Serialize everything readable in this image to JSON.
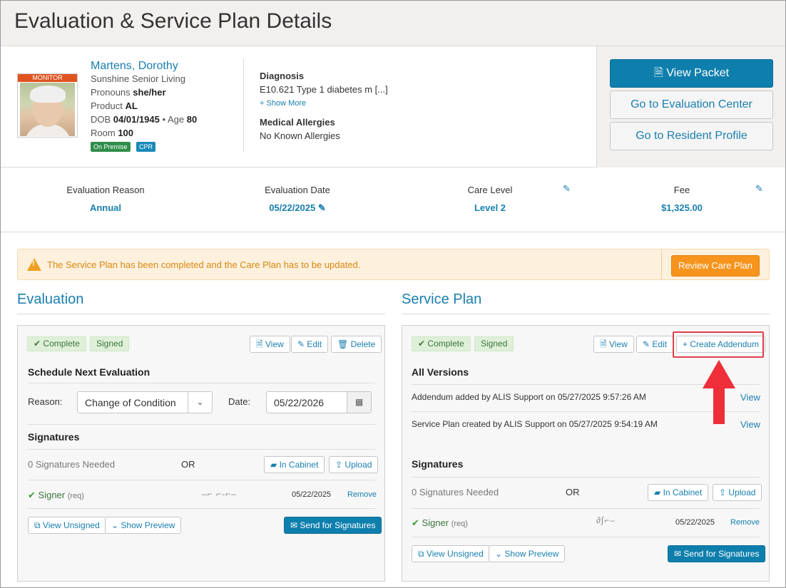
{
  "page": {
    "title": "Evaluation & Service Plan Details"
  },
  "resident": {
    "monitor_label": "MONITOR",
    "name": "Martens, Dorothy",
    "facility": "Sunshine Senior Living",
    "pronouns_label": "Pronouns",
    "pronouns": "she/her",
    "product_label": "Product",
    "product": "AL",
    "dob_label": "DOB",
    "dob": "04/01/1945",
    "age_sep": "•",
    "age_label": "Age",
    "age": "80",
    "room_label": "Room",
    "room": "100",
    "badges": [
      "On Premise",
      "CPR"
    ]
  },
  "medical": {
    "diagnosis_label": "Diagnosis",
    "diagnosis": "E10.621 Type 1 diabetes m [...]",
    "show_more": "Show More",
    "allergies_label": "Medical Allergies",
    "allergies": "No Known Allergies"
  },
  "actions": {
    "view_packet": "View Packet",
    "go_eval_center": "Go to Evaluation Center",
    "go_resident_profile": "Go to Resident Profile"
  },
  "info": {
    "reason_label": "Evaluation Reason",
    "reason": "Annual",
    "date_label": "Evaluation Date",
    "date": "05/22/2025",
    "care_label": "Care Level",
    "care": "Level 2",
    "fee_label": "Fee",
    "fee": "$1,325.00"
  },
  "alert": {
    "message": "The Service Plan has been completed and the Care Plan has to be updated.",
    "button": "Review Care Plan"
  },
  "evaluation": {
    "title": "Evaluation",
    "status": "Complete",
    "signed": "Signed",
    "view": "View",
    "edit": "Edit",
    "delete": "Delete",
    "schedule_title": "Schedule Next Evaluation",
    "reason_label": "Reason:",
    "reason_value": "Change of Condition",
    "date_label": "Date:",
    "date_value": "05/22/2026",
    "signatures_title": "Signatures",
    "sig_needed": "0 Signatures Needed",
    "or": "OR",
    "in_cabinet": "In Cabinet",
    "upload": "Upload",
    "signer": "Signer",
    "req": "(req)",
    "signed_date": "05/22/2025",
    "remove": "Remove",
    "view_unsigned": "View Unsigned",
    "show_preview": "Show Preview",
    "send": "Send for Signatures"
  },
  "service_plan": {
    "title": "Service Plan",
    "status": "Complete",
    "signed": "Signed",
    "view": "View",
    "edit": "Edit",
    "create_addendum": "Create Addendum",
    "versions_title": "All Versions",
    "versions": [
      {
        "text": "Addendum added by ALIS Support on 05/27/2025 9:57:26 AM",
        "link": "View"
      },
      {
        "text": "Service Plan created by ALIS Support on 05/27/2025 9:54:19 AM",
        "link": "View"
      }
    ],
    "signatures_title": "Signatures",
    "sig_needed": "0 Signatures Needed",
    "or": "OR",
    "in_cabinet": "In Cabinet",
    "upload": "Upload",
    "signer": "Signer",
    "req": "(req)",
    "signed_date": "05/22/2025",
    "remove": "Remove",
    "view_unsigned": "View Unsigned",
    "show_preview": "Show Preview",
    "send": "Send for Signatures"
  },
  "colors": {
    "accent": "#1a7fb0",
    "primary_button": "#0e7fad",
    "warning": "#f7941d",
    "success": "#3c763d",
    "highlight": "#e04048"
  }
}
